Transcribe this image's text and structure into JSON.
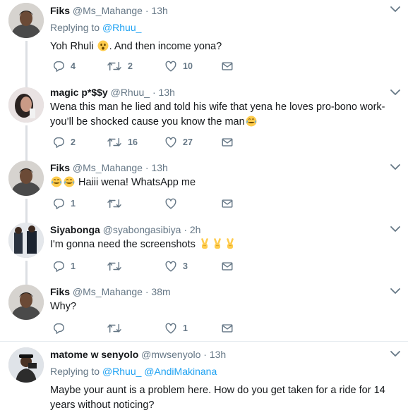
{
  "tweets": [
    {
      "name": "Fiks",
      "handle": "@Ms_Mahange",
      "time": "13h",
      "reply_label": "Replying to",
      "reply_to": "@Rhuu_",
      "text_before": "Yoh Rhuli",
      "text_after": ". And then income yona?",
      "emoji": "astonished-face",
      "replies": "4",
      "retweets": "2",
      "likes": "10"
    },
    {
      "name": "magic p*$$y",
      "handle": "@Rhuu_",
      "time": "13h",
      "text": "Wena this man he lied and told his wife that yena he loves pro-bono work- you’ll be shocked cause you know the man",
      "emoji": "face-with-tears-of-joy",
      "replies": "2",
      "retweets": "16",
      "likes": "27"
    },
    {
      "name": "Fiks",
      "handle": "@Ms_Mahange",
      "time": "13h",
      "text": "Haiii wena! WhatsApp me",
      "emoji": "face-with-tears-of-joy",
      "replies": "1",
      "retweets": "",
      "likes": ""
    },
    {
      "name": "Siyabonga",
      "handle": "@syabongasibiya",
      "time": "2h",
      "text": "I'm gonna need the screenshots",
      "emoji": "victory-hand",
      "replies": "1",
      "retweets": "",
      "likes": "3"
    },
    {
      "name": "Fiks",
      "handle": "@Ms_Mahange",
      "time": "38m",
      "text": "Why?",
      "replies": "",
      "retweets": "",
      "likes": "1"
    },
    {
      "name": "matome w senyolo",
      "handle": "@mwsenyolo",
      "time": "13h",
      "reply_label": "Replying to",
      "reply_to": "@Rhuu_",
      "reply_to_2": "@AndiMakinana",
      "text": "Maybe your aunt is a problem here. How do you get taken for a ride for 14 years without noticing?"
    }
  ],
  "separator": "·",
  "colors": {
    "accent": "#1da1f2",
    "muted": "#657786",
    "thread_line": "#dcdfe3",
    "divider": "#e6ecf0"
  },
  "icons": [
    "reply-icon",
    "retweet-icon",
    "like-icon",
    "direct-message-icon",
    "caret-down-icon"
  ]
}
